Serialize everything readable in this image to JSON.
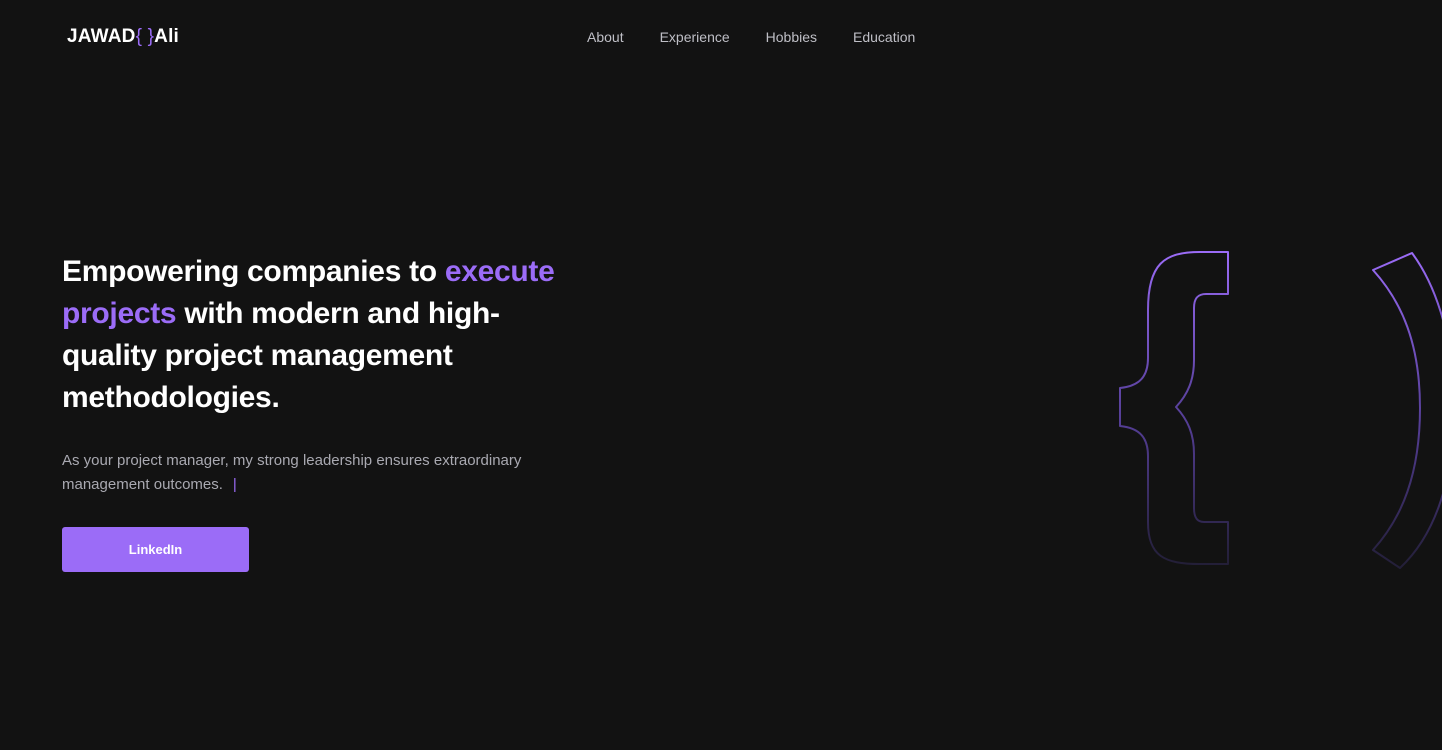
{
  "header": {
    "logo_first": "JAWAD",
    "logo_braces": "{ }",
    "logo_last": "Ali",
    "nav": [
      {
        "label": "About"
      },
      {
        "label": "Experience"
      },
      {
        "label": "Hobbies"
      },
      {
        "label": "Education"
      }
    ]
  },
  "hero": {
    "headline_part1": "Empowering companies to ",
    "headline_accent": "execute projects",
    "headline_part2": " with modern and high-quality project management methodologies.",
    "subtitle": "As your project manager, my strong leadership ensures extraordinary management outcomes.",
    "cursor_char": "|",
    "cta_label": "LinkedIn"
  },
  "colors": {
    "background": "#121212",
    "accent": "#9b6cf7",
    "text_primary": "#ffffff",
    "text_muted": "#a9a9b1"
  },
  "decoration": {
    "icon": "curly-braces-outline-icon"
  }
}
